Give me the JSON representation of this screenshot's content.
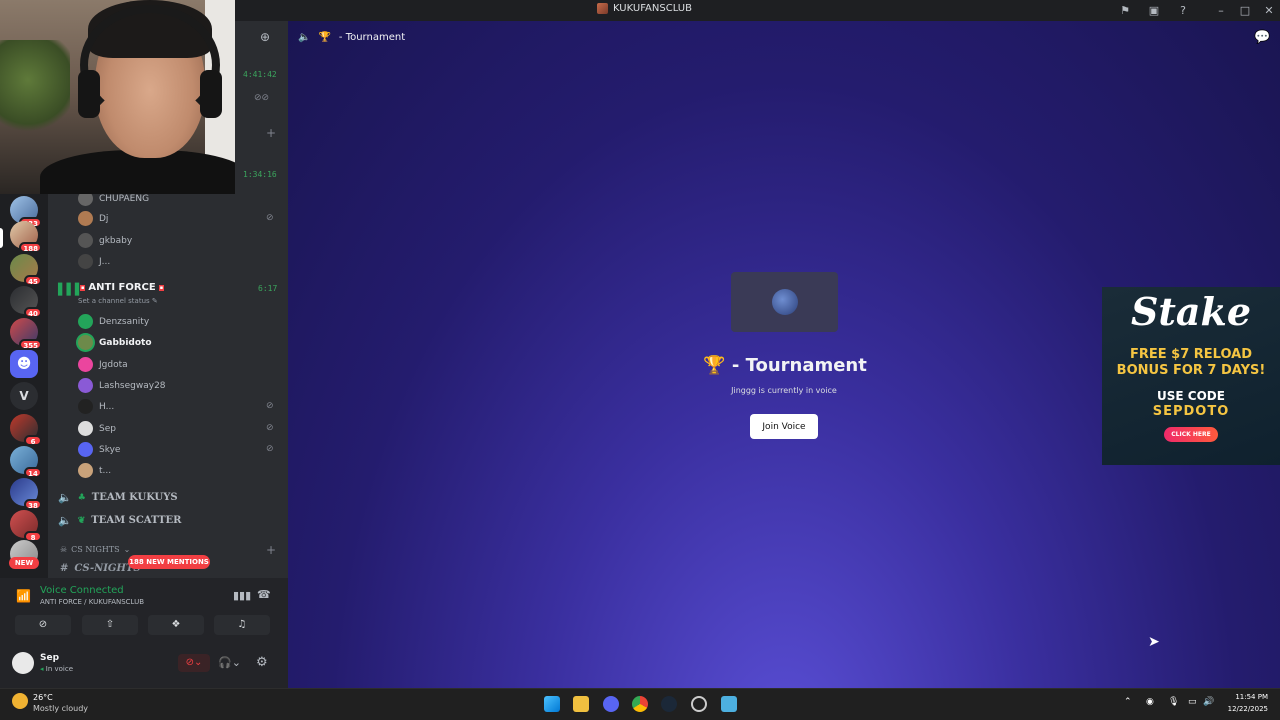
{
  "window": {
    "title": "KUKUFANSCLUB",
    "controls": [
      "minimize-icon",
      "maximize-icon",
      "close-icon"
    ],
    "toolbar_icons": [
      "flag-icon",
      "screen-icon",
      "help-icon"
    ]
  },
  "servers": [
    {
      "badge": "233"
    },
    {
      "badge": "188",
      "selected": true
    },
    {
      "badge": "45"
    },
    {
      "badge": "40"
    },
    {
      "badge": "355"
    },
    {
      "badge": ""
    },
    {
      "letter": "V"
    },
    {
      "badge": "6"
    },
    {
      "badge": "14"
    },
    {
      "badge": "38"
    },
    {
      "badge": "8"
    },
    {
      "badge": "NEW"
    }
  ],
  "sidebar": {
    "timers": [
      "4:41:42",
      "1:34:16",
      "6:17"
    ],
    "voice_users_top": [
      "CHUPAENG",
      "Dj",
      "gkbaby",
      "J..."
    ],
    "anti_force": {
      "name": "ANTI FORCE",
      "status": "Set a channel status",
      "members": [
        "Denzsanity",
        "Gabbidoto",
        "Jgdota",
        "Lashsegway28",
        "H...",
        "Sep",
        "Skye",
        "t..."
      ]
    },
    "channels": [
      "TEAM KUKUYS",
      "TEAM SCATTER"
    ],
    "category": "CS NIGHTS",
    "text_channel": "CS-NIGHTS",
    "mentions": "188 NEW MENTIONS"
  },
  "voice_panel": {
    "status": "Voice Connected",
    "location": "ANTI FORCE / KUKUFANSCLUB"
  },
  "user": {
    "name": "Sep",
    "status": "In voice"
  },
  "main": {
    "header_title": "- Tournament",
    "channel_title": "- Tournament",
    "subtitle": "Jinggg is currently in voice",
    "join_label": "Join Voice"
  },
  "ad": {
    "brand": "Stake",
    "promo": "FREE $7 RELOAD BONUS FOR 7 DAYS!",
    "use_code": "USE CODE",
    "code": "SEPDOTO",
    "cta": "CLICK HERE"
  },
  "taskbar": {
    "weather_temp": "26°C",
    "weather_desc": "Mostly cloudy",
    "time": "11:54 PM",
    "date": "12/22/2025"
  }
}
